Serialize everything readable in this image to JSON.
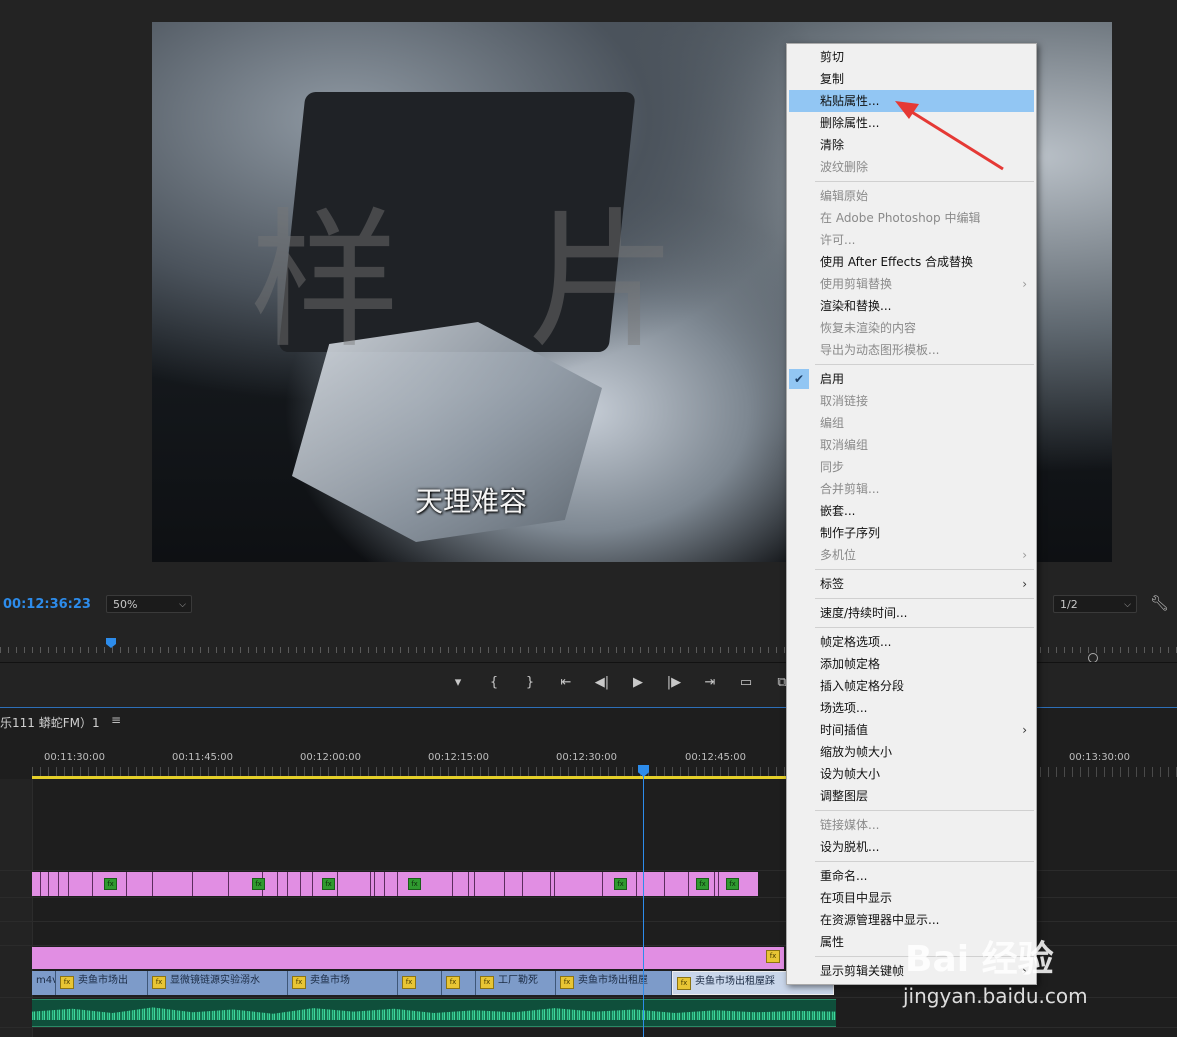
{
  "monitor": {
    "watermark": "样 片",
    "subtitle": "天理难容",
    "timecode": "00:12:36:23",
    "zoom": "50%",
    "resolution": "1/2"
  },
  "transport": {
    "marker_icon": "marker-icon",
    "in_icon": "mark-in-icon",
    "out_icon": "mark-out-icon",
    "goto_in_icon": "go-to-in-icon",
    "step_back_icon": "step-back-icon",
    "play_icon": "play-icon",
    "step_fwd_icon": "step-forward-icon",
    "goto_out_icon": "go-to-out-icon",
    "safe_margins_icon": "safe-margins-icon",
    "export_frame_icon": "export-frame-icon"
  },
  "timeline": {
    "sequence_name": "乐111  蟒蛇FM）1",
    "ruler": [
      "00:11:30:00",
      "00:11:45:00",
      "00:12:00:00",
      "00:12:15:00",
      "00:12:30:00",
      "00:12:45:00",
      "00:13:30:00"
    ],
    "clips": [
      {
        "label": "m4v",
        "fx": false
      },
      {
        "label": "卖鱼市场出",
        "fx": true
      },
      {
        "label": "显微镜链源实验溺水",
        "fx": true
      },
      {
        "label": "卖鱼市场",
        "fx": true
      },
      {
        "label": "",
        "fx": true
      },
      {
        "label": "",
        "fx": true
      },
      {
        "label": "工厂勒死",
        "fx": true
      },
      {
        "label": "卖鱼市场出租屋",
        "fx": true
      },
      {
        "label": "卖鱼市场出租屋踩",
        "fx": true
      }
    ],
    "fx_label": "fx"
  },
  "context_menu": {
    "items": [
      {
        "label": "剪切",
        "enabled": true
      },
      {
        "label": "复制",
        "enabled": true
      },
      {
        "label": "粘贴属性...",
        "enabled": true,
        "highlighted": true
      },
      {
        "label": "删除属性...",
        "enabled": true
      },
      {
        "label": "清除",
        "enabled": true
      },
      {
        "label": "波纹删除",
        "enabled": false
      },
      {
        "label": "编辑原始",
        "enabled": false
      },
      {
        "label": "在 Adobe Photoshop 中编辑",
        "enabled": false
      },
      {
        "label": "许可...",
        "enabled": false
      },
      {
        "label": "使用 After Effects 合成替换",
        "enabled": true
      },
      {
        "label": "使用剪辑替换",
        "enabled": false,
        "submenu": true
      },
      {
        "label": "渲染和替换...",
        "enabled": true
      },
      {
        "label": "恢复未渲染的内容",
        "enabled": false
      },
      {
        "label": "导出为动态图形模板...",
        "enabled": false
      },
      {
        "label": "启用",
        "enabled": true,
        "checked": true
      },
      {
        "label": "取消链接",
        "enabled": false
      },
      {
        "label": "编组",
        "enabled": false
      },
      {
        "label": "取消编组",
        "enabled": false
      },
      {
        "label": "同步",
        "enabled": false
      },
      {
        "label": "合并剪辑...",
        "enabled": false
      },
      {
        "label": "嵌套...",
        "enabled": true
      },
      {
        "label": "制作子序列",
        "enabled": true
      },
      {
        "label": "多机位",
        "enabled": false,
        "submenu": true
      },
      {
        "label": "标签",
        "enabled": true,
        "submenu": true
      },
      {
        "label": "速度/持续时间...",
        "enabled": true
      },
      {
        "label": "帧定格选项...",
        "enabled": true
      },
      {
        "label": "添加帧定格",
        "enabled": true
      },
      {
        "label": "插入帧定格分段",
        "enabled": true
      },
      {
        "label": "场选项...",
        "enabled": true
      },
      {
        "label": "时间插值",
        "enabled": true,
        "submenu": true
      },
      {
        "label": "缩放为帧大小",
        "enabled": true
      },
      {
        "label": "设为帧大小",
        "enabled": true
      },
      {
        "label": "调整图层",
        "enabled": true
      },
      {
        "label": "链接媒体...",
        "enabled": false
      },
      {
        "label": "设为脱机...",
        "enabled": true
      },
      {
        "label": "重命名...",
        "enabled": true
      },
      {
        "label": "在项目中显示",
        "enabled": true
      },
      {
        "label": "在资源管理器中显示...",
        "enabled": true
      },
      {
        "label": "属性",
        "enabled": true
      },
      {
        "label": "显示剪辑关键帧",
        "enabled": true,
        "submenu": true
      }
    ],
    "check_icon": "checkmark-icon",
    "submenu_glyph": "›"
  },
  "watermark_site": {
    "brand": "Bai 经验",
    "url": "jingyan.baidu.com"
  },
  "colors": {
    "accent": "#2d8ceb",
    "menu_highlight": "#92c6f3",
    "clip_pink": "#e18ee3",
    "clip_blue": "#7d9bc9",
    "audio_green": "#0f4f3b",
    "arrow_red": "#e53935"
  }
}
